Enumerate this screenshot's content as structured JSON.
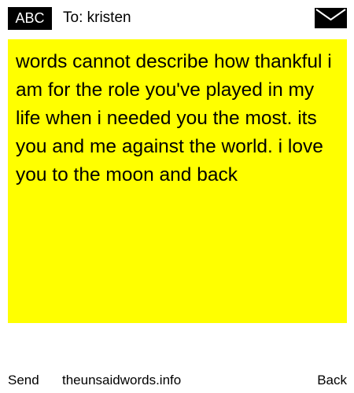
{
  "header": {
    "badge": "ABC",
    "to_line": "To: kristen",
    "mail_icon": "envelope-icon"
  },
  "message": {
    "text": "words cannot describe how thankful i am for the role you've played in my life when i needed you the most. its you and me against the world. i love you to the moon and back",
    "background": "#ffff00"
  },
  "footer": {
    "send": "Send",
    "site": "theunsaidwords.info",
    "back": "Back"
  }
}
